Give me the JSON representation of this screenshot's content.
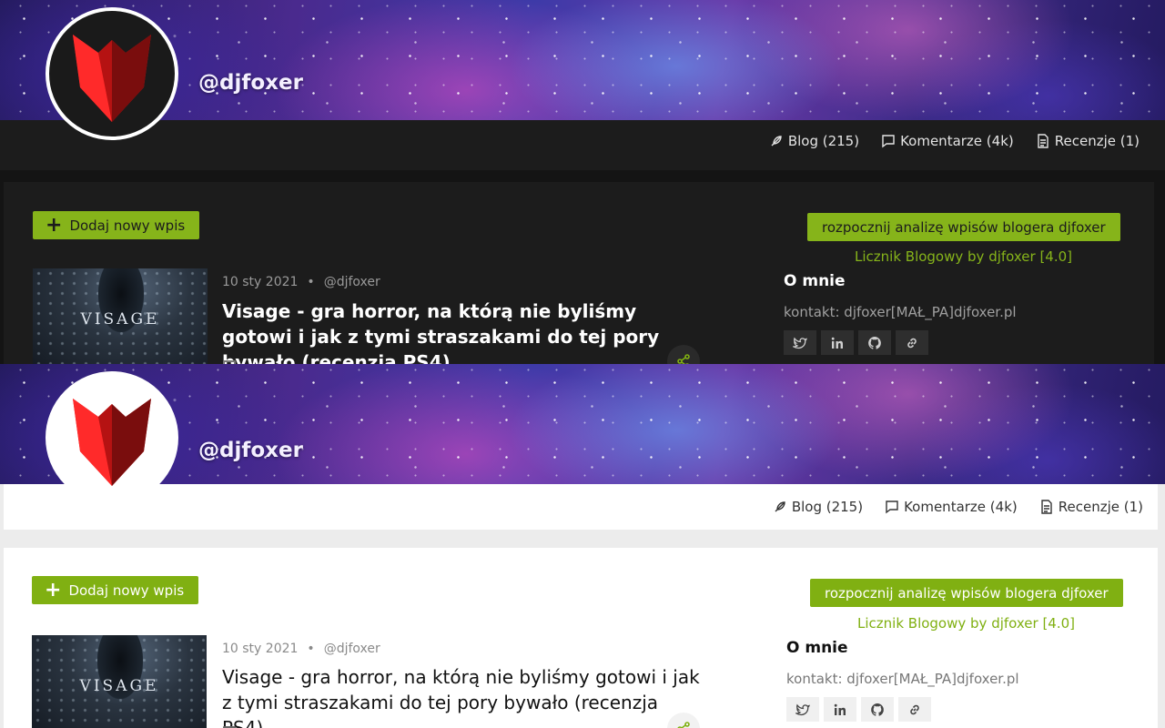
{
  "profile": {
    "username": "@djfoxer"
  },
  "nav": {
    "blog": "Blog (215)",
    "comments": "Komentarze (4k)",
    "reviews": "Recenzje (1)"
  },
  "actions": {
    "add_post": "Dodaj nowy wpis",
    "analyze": "rozpocznij analizę wpisów blogera djfoxer",
    "counter_link": "Licznik Blogowy by djfoxer [4.0]"
  },
  "post": {
    "date": "10 sty 2021",
    "separator": "•",
    "author": "@djfoxer",
    "title": "Visage - gra horror, na którą nie byliśmy gotowi i jak z tymi straszakami do tej pory bywało (recenzja PS4)",
    "thumbnail_text": "VISAGE"
  },
  "about": {
    "title": "O mnie",
    "contact": "kontakt: djfoxer[MAŁ_PA]djfoxer.pl"
  },
  "social_icons": [
    "twitter-icon",
    "linkedin-icon",
    "github-icon",
    "link-icon"
  ],
  "colors": {
    "accent": "#80b012",
    "dark_bg": "#1c1c1c",
    "light_bg": "#ffffff",
    "logo_red": "#d41a1a"
  }
}
